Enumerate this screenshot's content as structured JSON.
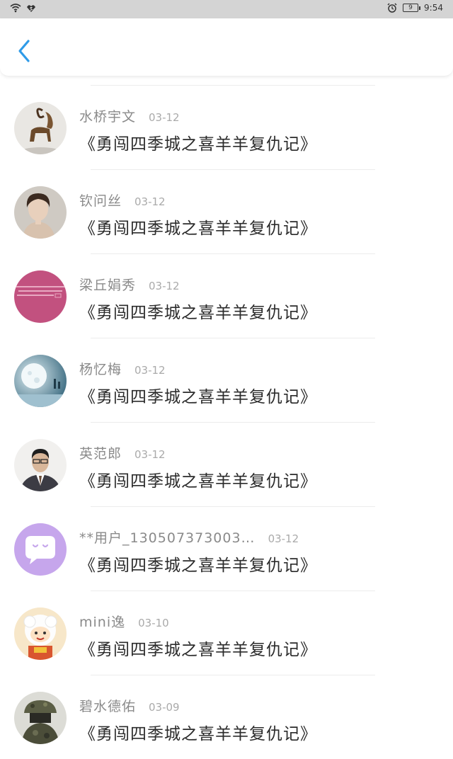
{
  "status_bar": {
    "icons_left": [
      "wifi-icon",
      "signal-icon"
    ],
    "icons_right": [
      "alarm-icon",
      "battery-icon"
    ],
    "battery_level": "9",
    "time": "9:54"
  },
  "header": {
    "back_icon": "chevron-left-icon",
    "accent_color": "#2f9be8"
  },
  "comments": [
    {
      "name": "水桥宇文",
      "date": "03-12",
      "title": "《勇闯四季城之喜羊羊复仇记》",
      "avatar": "goat-statue"
    },
    {
      "name": "钦问丝",
      "date": "03-12",
      "title": "《勇闯四季城之喜羊羊复仇记》",
      "avatar": "woman-portrait"
    },
    {
      "name": "梁丘娟秀",
      "date": "03-12",
      "title": "《勇闯四季城之喜羊羊复仇记》",
      "avatar": "pink-text-card"
    },
    {
      "name": "杨忆梅",
      "date": "03-12",
      "title": "《勇闯四季城之喜羊羊复仇记》",
      "avatar": "moon-night"
    },
    {
      "name": "英范郎",
      "date": "03-12",
      "title": "《勇闯四季城之喜羊羊复仇记》",
      "avatar": "man-suit"
    },
    {
      "name": "**用户_130507373003…",
      "date": "03-12",
      "title": "《勇闯四季城之喜羊羊复仇记》",
      "avatar": "chat-bubble-default"
    },
    {
      "name": "mini逸",
      "date": "03-10",
      "title": "《勇闯四季城之喜羊羊复仇记》",
      "avatar": "cartoon-goat"
    },
    {
      "name": "碧水德佑",
      "date": "03-09",
      "title": "《勇闯四季城之喜羊羊复仇记》",
      "avatar": "soldier-camo"
    }
  ]
}
